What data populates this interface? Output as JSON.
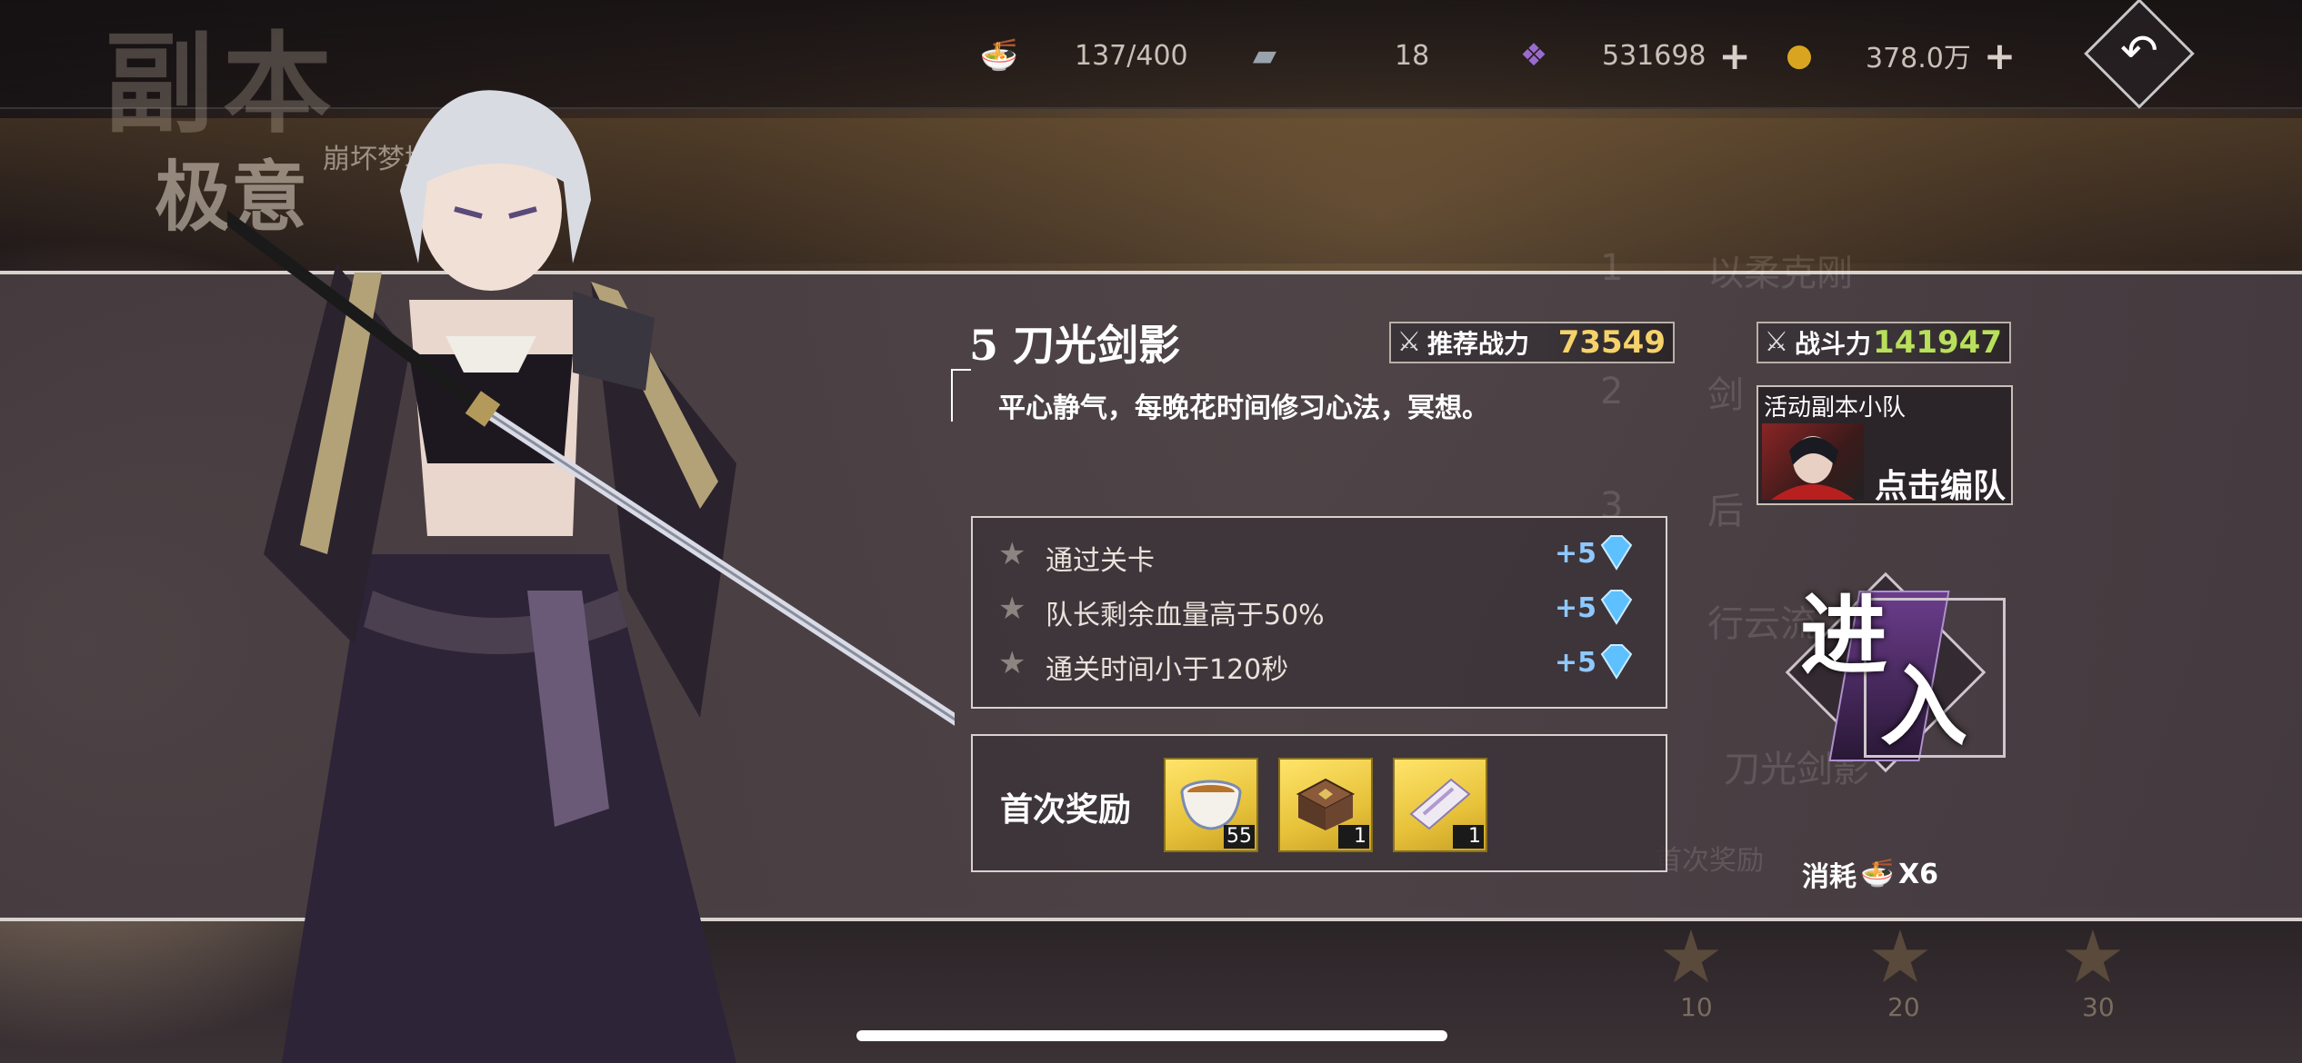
{
  "header": {
    "big_title": "副本",
    "sub_title": "极意",
    "sub_tag": "崩坏梦境",
    "resources": [
      {
        "icon": "noodle-bowl-icon",
        "value": "137/400",
        "has_plus": false
      },
      {
        "icon": "ticket-icon",
        "value": "18",
        "has_plus": false
      },
      {
        "icon": "purple-crystal-icon",
        "value": "531698",
        "has_plus": true
      },
      {
        "icon": "gold-coin-icon",
        "value": "378.0万",
        "has_plus": true
      }
    ],
    "plus_symbol": "+",
    "back_icon": "↶"
  },
  "background": {
    "ghost_items": [
      "1",
      "以柔克刚",
      "2",
      "剑",
      "3",
      "后",
      "行云流",
      "刀光剑影",
      "首次奖励"
    ],
    "floor_marks": [
      "10",
      "20",
      "30"
    ]
  },
  "stage": {
    "title": "5 刀光剑影",
    "description": "平心静气，每晚花时间修习心法，冥想。",
    "recommended_power_label": "推荐战力",
    "recommended_power_value": "73549",
    "power_label": "战斗力",
    "power_value": "141947",
    "power_icon": "sword-icon"
  },
  "team": {
    "label": "活动副本小队",
    "action": "点击编队"
  },
  "objectives": [
    {
      "text": "通过关卡",
      "reward": "+5"
    },
    {
      "text": "队长剩余血量高于50%",
      "reward": "+5"
    },
    {
      "text": "通关时间小于120秒",
      "reward": "+5"
    }
  ],
  "first_reward": {
    "label": "首次奖励",
    "items": [
      {
        "name": "tea-bowl",
        "count": "55"
      },
      {
        "name": "treasure-box",
        "count": "1"
      },
      {
        "name": "ticket-item",
        "count": "1"
      }
    ]
  },
  "enter": {
    "char1": "进",
    "char2": "入"
  },
  "cost": {
    "label": "消耗",
    "value": "X6"
  },
  "colors": {
    "recommended_power": "#f5d36a",
    "power": "#b8e05a",
    "reward_text": "#8ec8ff",
    "item_bg": "#e7c23a"
  }
}
